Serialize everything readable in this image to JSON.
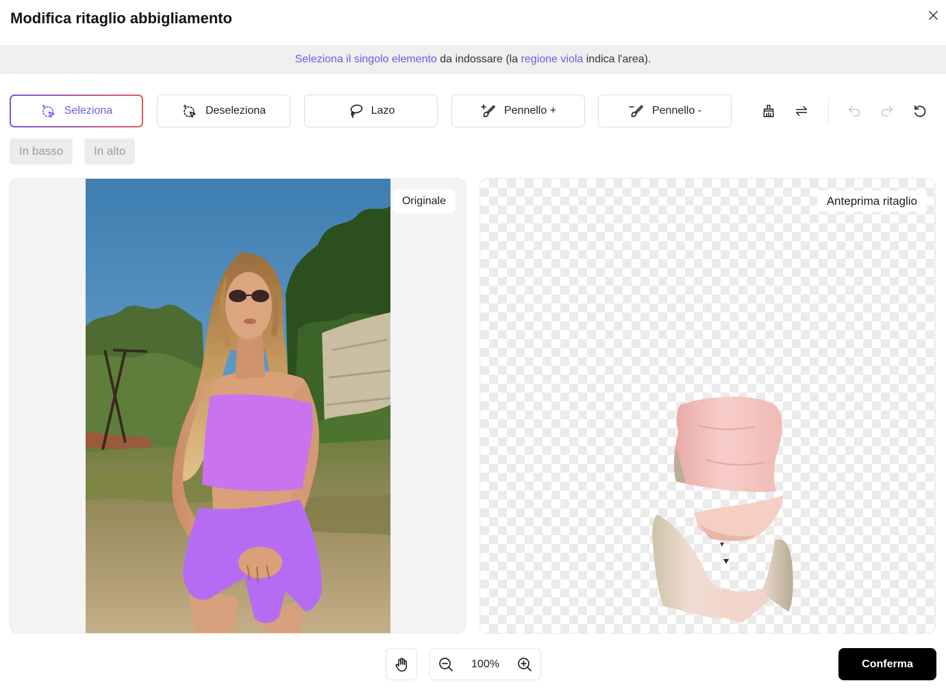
{
  "dialog": {
    "title": "Modifica ritaglio abbigliamento",
    "close_icon": "close-icon"
  },
  "instruction": {
    "highlight_1": "Seleziona il singolo elemento",
    "text_1": " da indossare (la ",
    "highlight_2": "regione viola",
    "text_2": " indica l'area)."
  },
  "toolbar": {
    "tools": [
      {
        "label": "Seleziona",
        "icon": "magic-select-icon",
        "active": true
      },
      {
        "label": "Deseleziona",
        "icon": "magic-deselect-icon",
        "active": false
      },
      {
        "label": "Lazo",
        "icon": "lasso-icon",
        "active": false
      },
      {
        "label": "Pennello +",
        "icon": "brush-add-icon",
        "active": false
      },
      {
        "label": "Pennello -",
        "icon": "brush-erase-icon",
        "active": false
      }
    ],
    "actions": [
      {
        "icon": "clear-brush-icon",
        "disabled": false
      },
      {
        "icon": "swap-icon",
        "disabled": false
      },
      {
        "icon": "undo-icon",
        "disabled": true
      },
      {
        "icon": "redo-icon",
        "disabled": true
      },
      {
        "icon": "reset-icon",
        "disabled": false
      }
    ]
  },
  "layer_buttons": [
    {
      "label": "In basso",
      "disabled": true
    },
    {
      "label": "In alto",
      "disabled": true
    }
  ],
  "canvas": {
    "original_label": "Originale",
    "preview_label": "Anteprima ritaglio"
  },
  "footer": {
    "pan_icon": "hand-icon",
    "zoom_out_icon": "zoom-out-icon",
    "zoom_level": "100%",
    "zoom_in_icon": "zoom-in-icon",
    "confirm_label": "Conferma"
  },
  "colors": {
    "accent": "#7656e3",
    "accent_end": "#e2585a",
    "selection_top": "#c974ee",
    "selection_shorts": "#b56cf2",
    "confirm_bg": "#000000",
    "banner_bg": "#efefef"
  }
}
